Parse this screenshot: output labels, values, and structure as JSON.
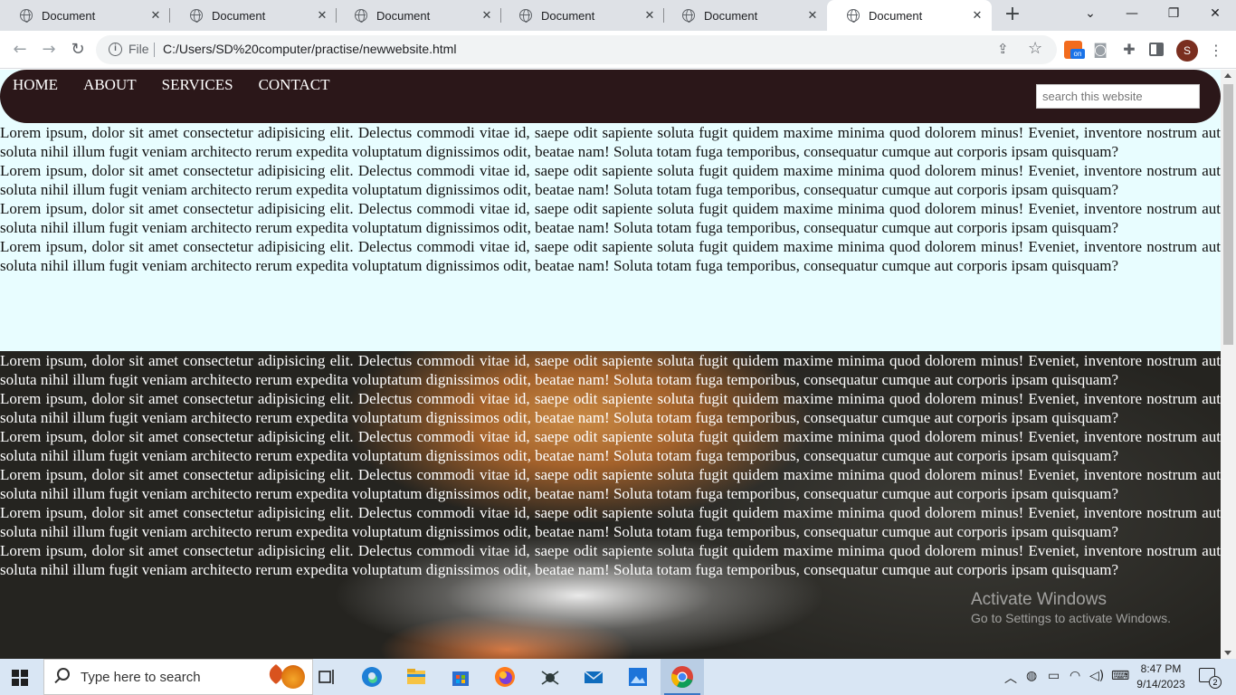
{
  "browser": {
    "tabs": [
      {
        "title": "Document",
        "active": false
      },
      {
        "title": "Document",
        "active": false
      },
      {
        "title": "Document",
        "active": false
      },
      {
        "title": "Document",
        "active": false
      },
      {
        "title": "Document",
        "active": false
      },
      {
        "title": "Document",
        "active": true
      }
    ],
    "address": {
      "scheme": "File",
      "url": "C:/Users/SD%20computer/practise/newwebsite.html"
    },
    "profile_initial": "S"
  },
  "page": {
    "nav": {
      "links": [
        "HOME",
        "ABOUT",
        "SERVICES",
        "CONTACT"
      ],
      "search_placeholder": "search this website"
    },
    "lorem": "Lorem ipsum, dolor sit amet consectetur adipisicing elit. Delectus commodi vitae id, saepe odit sapiente soluta fugit quidem maxime minima quod dolorem minus! Eveniet, inventore nostrum aut soluta nihil illum fugit veniam architecto rerum expedita voluptatum dignissimos odit, beatae nam! Soluta totam fuga temporibus, consequatur cumque aut corporis ipsam quisquam?",
    "light_paragraph_count": 4,
    "dark_paragraph_count": 6
  },
  "watermark": {
    "line1": "Activate Windows",
    "line2": "Go to Settings to activate Windows."
  },
  "taskbar": {
    "search_placeholder": "Type here to search",
    "time": "8:47 PM",
    "date": "9/14/2023",
    "notification_count": "2",
    "apps": [
      "task-view-icon",
      "edge-icon",
      "file-explorer-icon",
      "store-icon",
      "firefox-icon",
      "spider-icon",
      "mail-icon",
      "photos-icon",
      "chrome-icon"
    ]
  }
}
